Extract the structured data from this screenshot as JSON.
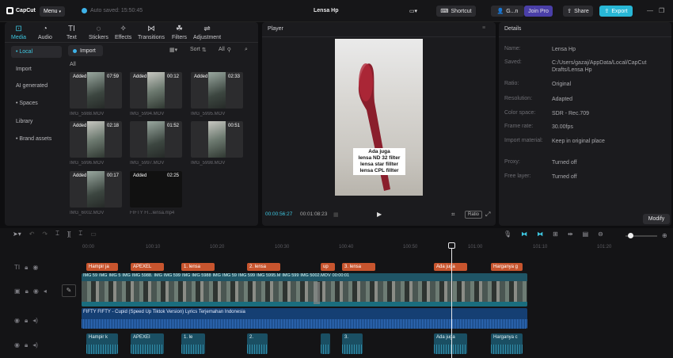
{
  "app": {
    "logo": "CapCut",
    "menu": "Menu",
    "autosave": "Auto saved: 15:50:45",
    "project_title": "Lensa Hp"
  },
  "topbar": {
    "shortcut": "Shortcut",
    "user": "G...n",
    "join_pro": "Join Pro",
    "share": "Share",
    "export": "Export"
  },
  "tools": [
    {
      "label": "Media",
      "icon": "media-icon"
    },
    {
      "label": "Audio",
      "icon": "audio-icon"
    },
    {
      "label": "Text",
      "icon": "text-icon"
    },
    {
      "label": "Stickers",
      "icon": "stickers-icon"
    },
    {
      "label": "Effects",
      "icon": "effects-icon"
    },
    {
      "label": "Transitions",
      "icon": "transitions-icon"
    },
    {
      "label": "Filters",
      "icon": "filters-icon"
    },
    {
      "label": "Adjustment",
      "icon": "adjustment-icon"
    }
  ],
  "sidebar": [
    "• Local",
    "Import",
    "AI generated",
    "• Spaces",
    "Library",
    "• Brand assets"
  ],
  "media": {
    "import": "Import",
    "sort": "Sort",
    "all_filter": "All",
    "all_label": "All",
    "items": [
      {
        "added": "Added",
        "duration": "07:59",
        "name": "IMG_5988.MOV"
      },
      {
        "added": "Added",
        "duration": "00:12",
        "name": "IMG_5994.MOV"
      },
      {
        "added": "Added",
        "duration": "02:33",
        "name": "IMG_5995.MOV"
      },
      {
        "added": "Added",
        "duration": "02:18",
        "name": "IMG_5996.MOV"
      },
      {
        "added": "",
        "duration": "01:52",
        "name": "IMG_5997.MOV"
      },
      {
        "added": "",
        "duration": "00:51",
        "name": "IMG_5998.MOV"
      },
      {
        "added": "Added",
        "duration": "00:17",
        "name": "IMG_6002.MOV"
      },
      {
        "added": "Added",
        "duration": "02:25",
        "name": "FIFTY FI...lensa.mp4"
      }
    ]
  },
  "player": {
    "title": "Player",
    "overlay": [
      "Ada juga",
      "lensa ND 32 filter",
      "lensa star fillter",
      "lensa CPL fillter"
    ],
    "current_time": "00:00:56:27",
    "total_time": "00:01:08:23",
    "ratio_btn": "Ratio"
  },
  "details": {
    "title": "Details",
    "rows": [
      {
        "k": "Name:",
        "v": "Lensa Hp"
      },
      {
        "k": "Saved:",
        "v": "C:/Users/gazaj/AppData/Local/CapCut Drafts/Lensa Hp"
      },
      {
        "k": "Ratio:",
        "v": "Original"
      },
      {
        "k": "Resolution:",
        "v": "Adapted"
      },
      {
        "k": "Color space:",
        "v": "SDR - Rec.709"
      },
      {
        "k": "Frame rate:",
        "v": "30.00fps"
      },
      {
        "k": "Import material:",
        "v": "Keep in original place"
      },
      {
        "k": "Proxy:",
        "v": "Turned off"
      },
      {
        "k": "Free layer:",
        "v": "Turned off"
      }
    ],
    "modify": "Modify"
  },
  "timeline": {
    "ruler": [
      "00:00",
      "100:10",
      "100:20",
      "100:30",
      "100:40",
      "100:50",
      "101:00",
      "101:10",
      "101:20"
    ],
    "text_clips": [
      "Hampir ja",
      "APEXEL",
      "1. lensa",
      "2. lensa",
      "up",
      "3. lensa",
      "Ada juga",
      "Harganya g"
    ],
    "video_labels": [
      "IMG 59",
      "IMG",
      "IMG 5",
      "IMG",
      "IMG 5988.",
      "IMG",
      "IMG 599",
      "IMG",
      "IMG 5988",
      "IMG",
      "IMG 59",
      "IMG 599",
      "IMG 5995.M",
      "IMG 599",
      "IMG 5002.MOV",
      "00:00:01"
    ],
    "audio_clip": "FIFTY FIFTY - Cupid (Speed Up Tiktok Version) Lyrics Terjemahan Indonesia",
    "bottom_clips": [
      "Hampir k",
      "APEXEI",
      "1. le",
      "2.",
      "",
      "3.",
      "Ada juga",
      "Harganya c"
    ]
  }
}
